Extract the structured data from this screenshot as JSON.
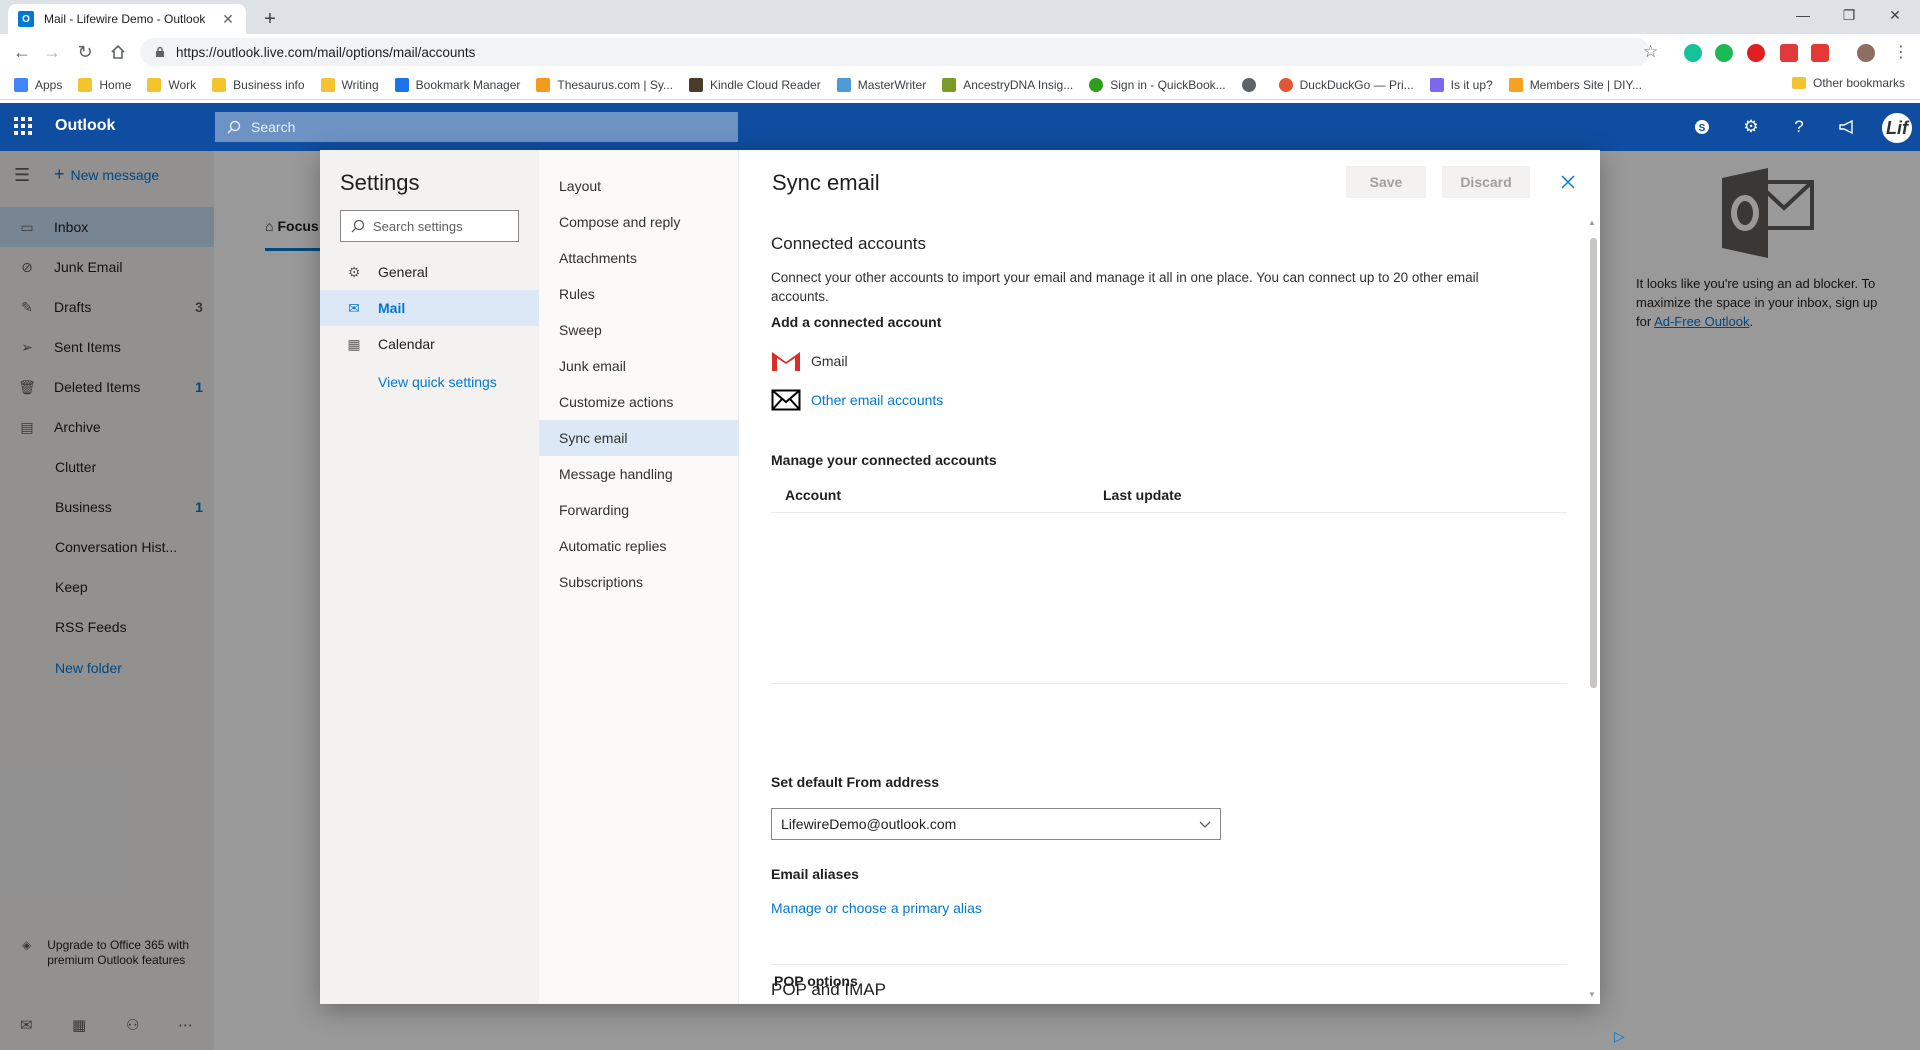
{
  "browser": {
    "tab_title": "Mail - Lifewire Demo - Outlook",
    "url": "https://outlook.live.com/mail/options/mail/accounts",
    "bookmarks": [
      {
        "label": "Apps",
        "icon": "apps-grid-icon",
        "color": "#4285f4"
      },
      {
        "label": "Home",
        "icon": "folder-icon",
        "color": "#f4c430"
      },
      {
        "label": "Work",
        "icon": "folder-icon",
        "color": "#f4c430"
      },
      {
        "label": "Business info",
        "icon": "folder-icon",
        "color": "#f4c430"
      },
      {
        "label": "Writing",
        "icon": "folder-icon",
        "color": "#f4c430"
      },
      {
        "label": "Bookmark Manager",
        "icon": "star-icon",
        "color": "#1a73e8"
      },
      {
        "label": "Thesaurus.com | Sy...",
        "icon": "thesaurus-icon",
        "color": "#f49b1f"
      },
      {
        "label": "Kindle Cloud Reader",
        "icon": "kindle-icon",
        "color": "#4a3b2a"
      },
      {
        "label": "MasterWriter",
        "icon": "masterwriter-icon",
        "color": "#4d9ad4"
      },
      {
        "label": "AncestryDNA Insig...",
        "icon": "ancestry-icon",
        "color": "#7a9a2a"
      },
      {
        "label": "Sign in - QuickBook...",
        "icon": "quickbooks-icon",
        "color": "#2ca01c"
      },
      {
        "label": "",
        "icon": "globe-icon",
        "color": "#5f6368"
      },
      {
        "label": "DuckDuckGo — Pri...",
        "icon": "duckduckgo-icon",
        "color": "#de5833"
      },
      {
        "label": "Is it up?",
        "icon": "wrench-icon",
        "color": "#7b68ee"
      },
      {
        "label": "Members Site | DIY...",
        "icon": "members-icon",
        "color": "#f4a21f"
      }
    ],
    "other_bookmarks": "Other bookmarks"
  },
  "header": {
    "app_name": "Outlook",
    "search_placeholder": "Search",
    "accent": "#0f4da0",
    "avatar_text": "Lif"
  },
  "nav": {
    "new_message": "New message",
    "folders": [
      {
        "name": "Inbox",
        "icon": "inbox-icon",
        "count": "",
        "active": true
      },
      {
        "name": "Junk Email",
        "icon": "blocked-icon",
        "count": ""
      },
      {
        "name": "Drafts",
        "icon": "pencil-icon",
        "count": "3"
      },
      {
        "name": "Sent Items",
        "icon": "send-icon",
        "count": ""
      },
      {
        "name": "Deleted Items",
        "icon": "trash-icon",
        "count": "1"
      },
      {
        "name": "Archive",
        "icon": "archive-icon",
        "count": ""
      },
      {
        "name": "Clutter",
        "icon": "",
        "count": ""
      },
      {
        "name": "Business",
        "icon": "",
        "count": "1"
      },
      {
        "name": "Conversation Hist...",
        "icon": "",
        "count": ""
      },
      {
        "name": "Keep",
        "icon": "",
        "count": ""
      },
      {
        "name": "RSS Feeds",
        "icon": "",
        "count": ""
      }
    ],
    "new_folder": "New folder",
    "upgrade_text": "Upgrade to Office 365 with premium Outlook features"
  },
  "list": {
    "focused_tab": "Focus"
  },
  "ad": {
    "text": "It looks like you're using an ad blocker. To maximize the space in your inbox, sign up for ",
    "link": "Ad-Free Outlook",
    "end": "."
  },
  "settings": {
    "title": "Settings",
    "search_placeholder": "Search settings",
    "categories": [
      {
        "label": "General",
        "icon": "gear-icon"
      },
      {
        "label": "Mail",
        "icon": "mail-icon",
        "active": true
      },
      {
        "label": "Calendar",
        "icon": "calendar-icon"
      }
    ],
    "quick_settings": "View quick settings",
    "mail_sections": [
      "Layout",
      "Compose and reply",
      "Attachments",
      "Rules",
      "Sweep",
      "Junk email",
      "Customize actions",
      "Sync email",
      "Message handling",
      "Forwarding",
      "Automatic replies",
      "Subscriptions"
    ],
    "active_section": "Sync email"
  },
  "pane": {
    "title": "Sync email",
    "save": "Save",
    "discard": "Discard",
    "connected_heading": "Connected accounts",
    "connected_desc": "Connect your other accounts to import your email and manage it all in one place. You can connect up to 20 other email accounts.",
    "add_heading": "Add a connected account",
    "gmail": "Gmail",
    "other_accounts": "Other email accounts",
    "manage_heading": "Manage your connected accounts",
    "col_account": "Account",
    "col_last_update": "Last update",
    "default_from_heading": "Set default From address",
    "default_from_value": "LifewireDemo@outlook.com",
    "aliases_heading": "Email aliases",
    "aliases_link": "Manage or choose a primary alias",
    "pop_heading": "POP and IMAP",
    "pop_options": "POP options"
  }
}
